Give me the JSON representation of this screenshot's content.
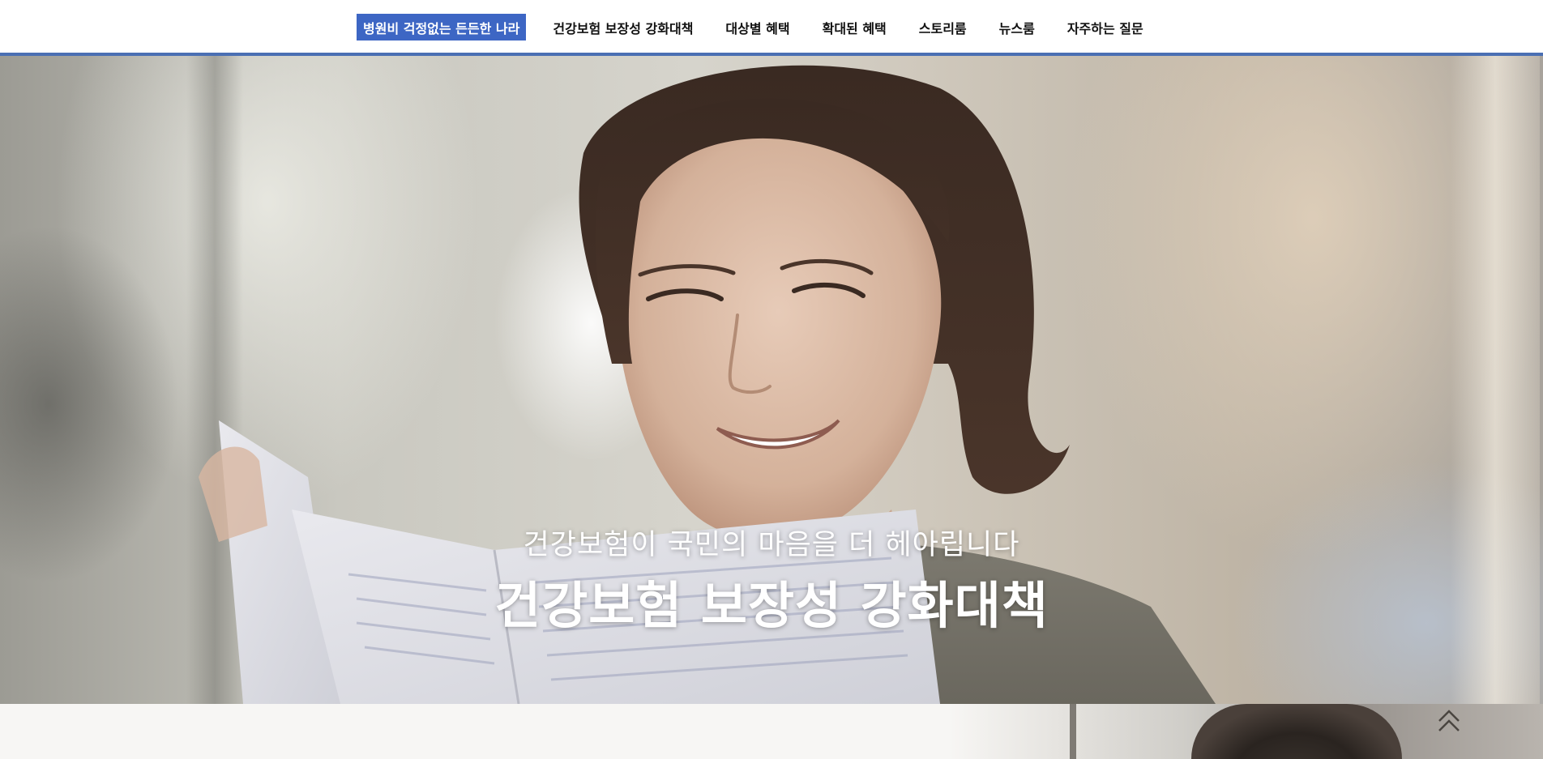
{
  "nav": {
    "brand": "병원비 걱정없는 든든한 나라",
    "items": [
      {
        "label": "건강보험 보장성 강화대책"
      },
      {
        "label": "대상별 혜택"
      },
      {
        "label": "확대된 혜택"
      },
      {
        "label": "스토리룸"
      },
      {
        "label": "뉴스룸"
      },
      {
        "label": "자주하는 질문"
      }
    ],
    "accent_color": "#3d66c4",
    "border_color": "#4a6fb3"
  },
  "hero": {
    "subtitle": "건강보험이 국민의 마음을 더 헤아립니다",
    "title": "건강보험 보장성 강화대책",
    "image_subject": "woman-reading-document-photo"
  },
  "scroll_top": {
    "icon": "double-chevron-up-icon"
  }
}
